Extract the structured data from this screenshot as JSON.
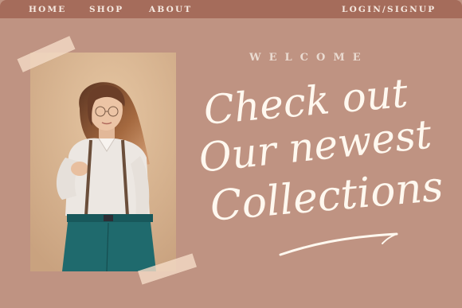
{
  "nav": {
    "items": [
      {
        "label": "HOME"
      },
      {
        "label": "SHOP"
      },
      {
        "label": "ABOUT"
      }
    ],
    "auth_label": "LOGIN/SIGNUP"
  },
  "hero": {
    "kicker": "WELCOME",
    "headline_lines": [
      "Check out",
      "Our newest",
      "Collections"
    ]
  },
  "colors": {
    "background": "#bf9382",
    "navbar": "#a56c5b",
    "nav_text": "#f6e9e0",
    "headline_text": "#fff8ef",
    "tape": "#f3dac6"
  },
  "icons": {
    "underline_swoosh": "swoosh-underline-icon"
  }
}
